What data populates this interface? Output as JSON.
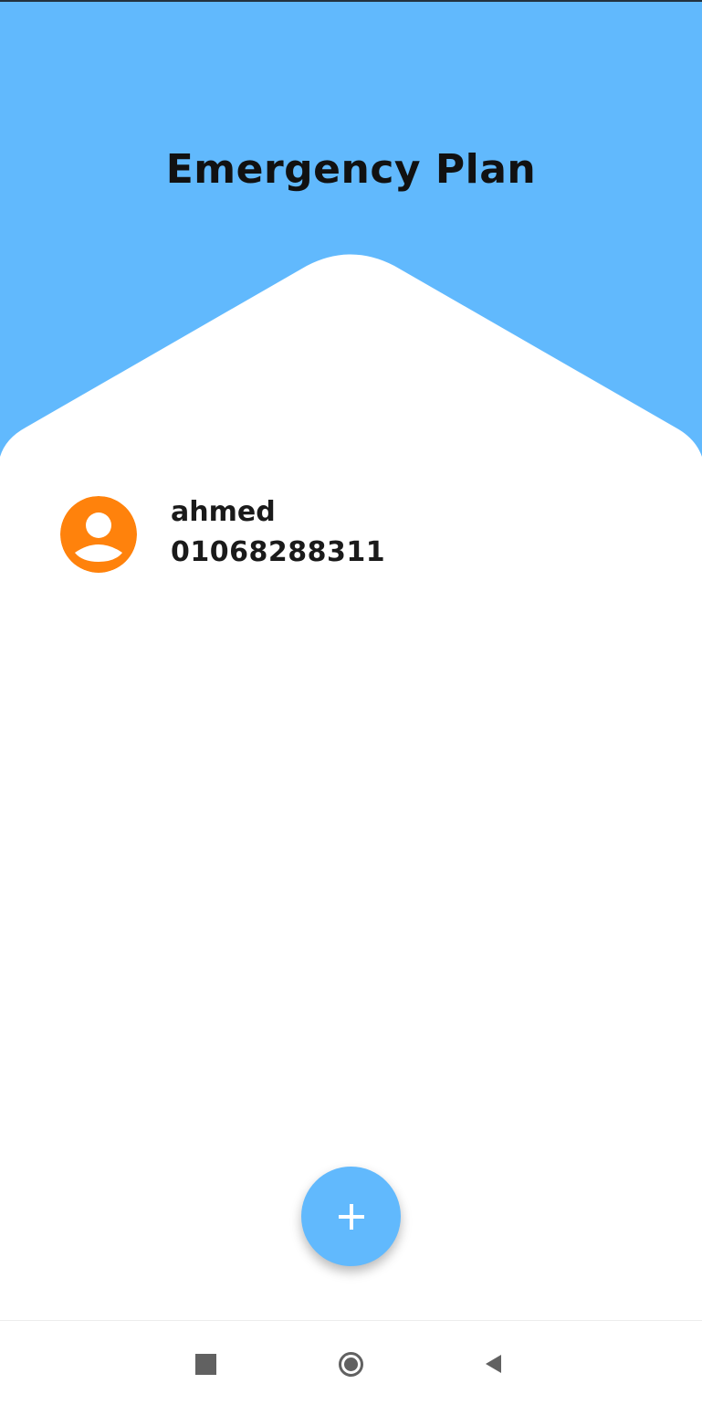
{
  "app": {
    "title": "Emergency Plan"
  },
  "colors": {
    "header": "#61b9fd",
    "avatar": "#ff820c",
    "fab": "#61b9fd",
    "nav_icons": "#616161"
  },
  "contacts": [
    {
      "name": "ahmed",
      "phone": "01068288311",
      "avatar_icon": "person-icon"
    }
  ],
  "fab": {
    "icon": "plus-icon"
  },
  "navigation": {
    "recent_icon": "square-icon",
    "home_icon": "circle-icon",
    "back_icon": "triangle-back-icon"
  }
}
